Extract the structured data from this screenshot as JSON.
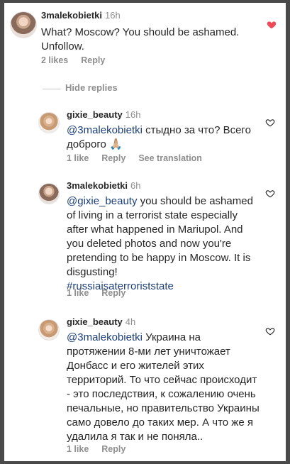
{
  "comments": [
    {
      "username": "3malekobietki",
      "time": "16h",
      "text": "What? Moscow? You should be ashamed. Unfollow.",
      "likes": "2 likes",
      "reply": "Reply",
      "liked": true
    },
    {
      "username": "gixie_beauty",
      "time": "16h",
      "mention": "@3malekobietki",
      "text": "стыдно за что? Всего доброго 🙏🏼",
      "likes": "1 like",
      "reply": "Reply",
      "translate": "See translation",
      "liked": false
    },
    {
      "username": "3malekobietki",
      "time": "6h",
      "mention": "@gixie_beauty",
      "text": "you should be ashamed of living in a terrorist state especially after what happened in Mariupol. And you deleted photos and now you're pretending to be happy in Moscow. It is disgusting!",
      "hashtag": "#russiaisaterroriststate",
      "likes": "1 like",
      "reply": "Reply",
      "liked": false
    },
    {
      "username": "gixie_beauty",
      "time": "4h",
      "mention": "@3malekobietki",
      "text": "Украина на протяжении 8-ми лет уничтожает Донбасс и его жителей этих территорий. То что сейчас происходит - это последствия, к сожалению очень печальные, но правительство Украины само довело до таких мер. А что же я удалила я так и не поняла..",
      "likes": "1 like",
      "reply": "Reply",
      "liked": false
    }
  ],
  "hide_replies": "Hide replies",
  "colors": {
    "liked_heart": "#ed4956",
    "mention": "#1b3f7a",
    "muted": "#8e8e8e"
  }
}
